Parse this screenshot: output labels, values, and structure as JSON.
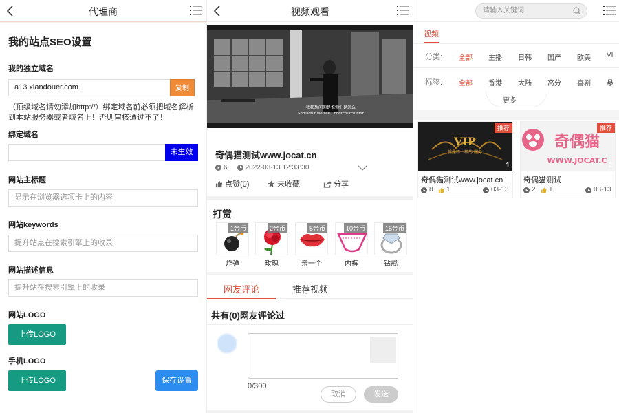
{
  "panel_seo": {
    "header_title": "代理商",
    "heading": "我的站点SEO设置",
    "domain_label": "我的独立域名",
    "domain_value": "a13.xiandouer.com",
    "copy_button": "复制",
    "note": "（顶级域名请勿添加http://）绑定域名前必须把域名解析到本站服务器或者域名上！否则审核通过不了！",
    "bind_label": "绑定域名",
    "bind_value": "",
    "bind_status_button": "未生效",
    "site_title_label": "网站主标题",
    "site_title_placeholder": "显示在浏览器选项卡上的内容",
    "keywords_label": "网站keywords",
    "keywords_placeholder": "提升站点在搜索引擎上的收录",
    "description_label": "网站描述信息",
    "description_placeholder": "提升站在搜索引擎上的收录",
    "logo_label": "网站LOGO",
    "logo_upload": "上传LOGO",
    "mobile_logo_label": "手机LOGO",
    "mobile_logo_upload": "上传LOGO",
    "save_button": "保存设置"
  },
  "panel_video": {
    "header_title": "视频观看",
    "subtitle_line1": "我都想问你是谁你们是怎么",
    "subtitle_line2": "Shouldn't we see Christchurch first",
    "video_title": "奇偶猫测试www.jocat.cn",
    "plays": "6",
    "datetime": "2022-03-13 12:33:30",
    "like": "点赞(0)",
    "favorite": "未收藏",
    "share": "分享",
    "reward_title": "打赏",
    "gifts": [
      {
        "price": "1金币",
        "name": "炸弹"
      },
      {
        "price": "2金币",
        "name": "玫瑰"
      },
      {
        "price": "5金币",
        "name": "亲一个"
      },
      {
        "price": "10金币",
        "name": "内裤"
      },
      {
        "price": "15金币",
        "name": "钻戒"
      }
    ],
    "tab_comments": "网友评论",
    "tab_recommend": "推荐视频",
    "comment_count_text": "共有(0)网友评论过",
    "char_count": "0/300",
    "cancel_button": "取消",
    "send_button": "发送"
  },
  "panel_list": {
    "search_placeholder": "请输入关键词",
    "video_tab": "视频",
    "category_label": "分类:",
    "categories": [
      "全部",
      "主播",
      "日韩",
      "国产",
      "欧美",
      "VI"
    ],
    "tag_label": "标签:",
    "tags": [
      "全部",
      "香港",
      "大陆",
      "高分",
      "喜剧",
      "悬"
    ],
    "more": "更多",
    "cards": [
      {
        "badge": "推荐",
        "num": "1",
        "title": "奇偶猫测试www.jocat.cn",
        "plays": "8",
        "likes": "1",
        "date": "03-13",
        "thumb_text": "VIP",
        "thumb_sub": "就是不一样的 服务"
      },
      {
        "badge": "推荐",
        "num": "2",
        "title": "奇偶猫测试",
        "plays": "2",
        "likes": "1",
        "date": "03-13",
        "thumb_text": "奇偶猫",
        "thumb_sub": "WWW.JOCAT.C"
      }
    ]
  },
  "colors": {
    "accent_red": "#e34d3b",
    "copy_orange": "#f08c38",
    "status_blue": "#0000ee",
    "upload_green": "#169b82",
    "save_blue": "#2d8cf0"
  }
}
